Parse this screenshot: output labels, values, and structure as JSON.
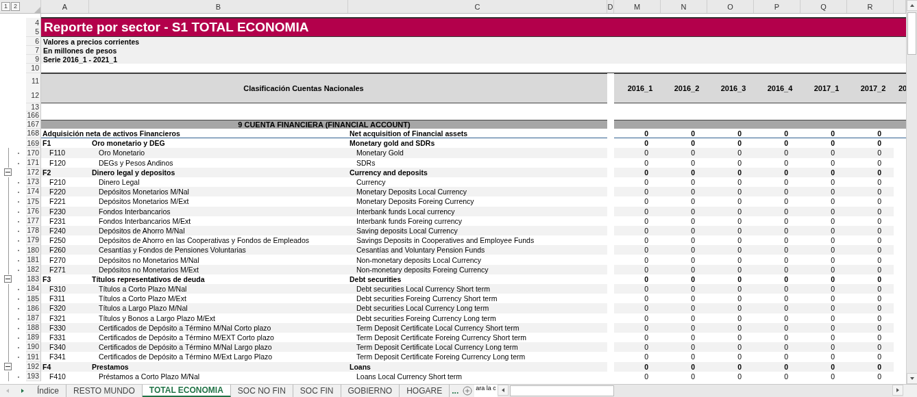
{
  "outline_levels": [
    "1",
    "2"
  ],
  "column_headers": [
    "A",
    "B",
    "C",
    "D",
    "M",
    "N",
    "O",
    "P",
    "Q",
    "R"
  ],
  "title": {
    "rows": [
      "4",
      "5"
    ],
    "text": "Reporte por sector - S1 TOTAL ECONOMIA"
  },
  "info_rows": [
    {
      "row": "6",
      "text": "Valores a precios corrientes"
    },
    {
      "row": "7",
      "text": "En millones de pesos"
    },
    {
      "row": "9",
      "text": "Serie 2016_1 - 2021_1"
    }
  ],
  "blank_rows": [
    "10"
  ],
  "header": {
    "rows": [
      "11",
      "12"
    ],
    "label": "Clasificación Cuentas Nacionales",
    "periods": [
      "2016_1",
      "2016_2",
      "2016_3",
      "2016_4",
      "2017_1",
      "2017_2",
      "20"
    ]
  },
  "spacer_rows": [
    "13",
    "166"
  ],
  "section": {
    "row": "167",
    "text": "9 CUENTA FINANCIERA (FINANCIAL ACCOUNT)"
  },
  "rows": [
    {
      "row": "168",
      "kind": "total",
      "label_es": "Adquisición neta de activos Financieros",
      "label_en": "Net acquisition of Financial assets",
      "values": [
        "0",
        "0",
        "0",
        "0",
        "0",
        "0"
      ]
    },
    {
      "row": "169",
      "kind": "group",
      "code": "F1",
      "label_es": "Oro monetario y DEG",
      "label_en": "Monetary gold and SDRs",
      "values": [
        "0",
        "0",
        "0",
        "0",
        "0",
        "0"
      ]
    },
    {
      "row": "170",
      "kind": "item",
      "code": "F110",
      "label_es": "Oro Monetario",
      "label_en": "Monetary Gold",
      "values": [
        "0",
        "0",
        "0",
        "0",
        "0",
        "0"
      ]
    },
    {
      "row": "171",
      "kind": "item",
      "code": "F120",
      "label_es": "DEGs y Pesos Andinos",
      "label_en": "SDRs",
      "values": [
        "0",
        "0",
        "0",
        "0",
        "0",
        "0"
      ]
    },
    {
      "row": "172",
      "kind": "group",
      "collapsible": true,
      "code": "F2",
      "label_es": "Dinero legal y depositos",
      "label_en": "Currency and deposits",
      "values": [
        "0",
        "0",
        "0",
        "0",
        "0",
        "0"
      ]
    },
    {
      "row": "173",
      "kind": "item",
      "code": "F210",
      "label_es": "Dinero Legal",
      "label_en": "Currency",
      "values": [
        "0",
        "0",
        "0",
        "0",
        "0",
        "0"
      ]
    },
    {
      "row": "174",
      "kind": "item",
      "code": "F220",
      "label_es": "Depósitos Monetarios M/Nal",
      "label_en": "Monetary Deposits Local Currency",
      "values": [
        "0",
        "0",
        "0",
        "0",
        "0",
        "0"
      ]
    },
    {
      "row": "175",
      "kind": "item",
      "code": "F221",
      "label_es": "Depósitos Monetarios M/Ext",
      "label_en": "Monetary Deposits Foreing Currency",
      "values": [
        "0",
        "0",
        "0",
        "0",
        "0",
        "0"
      ]
    },
    {
      "row": "176",
      "kind": "item",
      "code": "F230",
      "label_es": "Fondos Interbancarios",
      "label_en": "Interbank funds Local currency",
      "values": [
        "0",
        "0",
        "0",
        "0",
        "0",
        "0"
      ]
    },
    {
      "row": "177",
      "kind": "item",
      "code": "F231",
      "label_es": "Fondos Interbancarios M/Ext",
      "label_en": "Interbank funds Foreing currency",
      "values": [
        "0",
        "0",
        "0",
        "0",
        "0",
        "0"
      ]
    },
    {
      "row": "178",
      "kind": "item",
      "code": "F240",
      "label_es": "Depósitos de Ahorro M/Nal",
      "label_en": "Saving deposits Local Currency",
      "values": [
        "0",
        "0",
        "0",
        "0",
        "0",
        "0"
      ]
    },
    {
      "row": "179",
      "kind": "item",
      "code": "F250",
      "label_es": "Depósitos de Ahorro en las Cooperativas y Fondos de Empleados",
      "label_en": "Savings Deposits in Cooperatives and Employee Funds",
      "values": [
        "0",
        "0",
        "0",
        "0",
        "0",
        "0"
      ]
    },
    {
      "row": "180",
      "kind": "item",
      "code": "F260",
      "label_es": "Cesantías y Fondos de Pensiones Voluntarias",
      "label_en": "Cesantías and Voluntary Pension Funds",
      "values": [
        "0",
        "0",
        "0",
        "0",
        "0",
        "0"
      ]
    },
    {
      "row": "181",
      "kind": "item",
      "code": "F270",
      "label_es": "Depósitos no Monetarios M/Nal",
      "label_en": "Non-monetary deposits Local Currency",
      "values": [
        "0",
        "0",
        "0",
        "0",
        "0",
        "0"
      ]
    },
    {
      "row": "182",
      "kind": "item",
      "code": "F271",
      "label_es": "Depósitos no Monetarios M/Ext",
      "label_en": "Non-monetary deposits Foreing Currency",
      "values": [
        "0",
        "0",
        "0",
        "0",
        "0",
        "0"
      ]
    },
    {
      "row": "183",
      "kind": "group",
      "collapsible": true,
      "code": "F3",
      "label_es": "Títulos representativos de deuda",
      "label_en": "Debt securities",
      "values": [
        "0",
        "0",
        "0",
        "0",
        "0",
        "0"
      ]
    },
    {
      "row": "184",
      "kind": "item",
      "code": "F310",
      "label_es": "Títulos a Corto Plazo M/Nal",
      "label_en": "Debt securities Local Currency Short term",
      "values": [
        "0",
        "0",
        "0",
        "0",
        "0",
        "0"
      ]
    },
    {
      "row": "185",
      "kind": "item",
      "code": "F311",
      "label_es": "Títulos a Corto Plazo M/Ext",
      "label_en": "Debt securities Foreing Currency Short term",
      "values": [
        "0",
        "0",
        "0",
        "0",
        "0",
        "0"
      ]
    },
    {
      "row": "186",
      "kind": "item",
      "code": "F320",
      "label_es": "Títulos a Largo Plazo M/Nal",
      "label_en": "Debt securities Local Currency Long term",
      "values": [
        "0",
        "0",
        "0",
        "0",
        "0",
        "0"
      ]
    },
    {
      "row": "187",
      "kind": "item",
      "code": "F321",
      "label_es": "Títulos y Bonos a Largo Plazo M/Ext",
      "label_en": "Debt securities Foreing Currency Long term",
      "values": [
        "0",
        "0",
        "0",
        "0",
        "0",
        "0"
      ]
    },
    {
      "row": "188",
      "kind": "item",
      "code": "F330",
      "label_es": "Certificados de Depósito a Término M/Nal Corto plazo",
      "label_en": "Term Deposit Certificate Local Currency Short term",
      "values": [
        "0",
        "0",
        "0",
        "0",
        "0",
        "0"
      ]
    },
    {
      "row": "189",
      "kind": "item",
      "code": "F331",
      "label_es": "Certificados de Depósito a Término M/EXT Corto plazo",
      "label_en": "Term Deposit Certificate Foreing Currency Short term",
      "values": [
        "0",
        "0",
        "0",
        "0",
        "0",
        "0"
      ]
    },
    {
      "row": "190",
      "kind": "item",
      "code": "F340",
      "label_es": "Certificados de Depósito a Término M/Nal Largo plazo",
      "label_en": "Term Deposit Certificate Local Currency Long term",
      "values": [
        "0",
        "0",
        "0",
        "0",
        "0",
        "0"
      ]
    },
    {
      "row": "191",
      "kind": "item",
      "code": "F341",
      "label_es": "Certificados de Depósito a Término M/Ext Largo Plazo",
      "label_en": "Term Deposit Certificate Foreing Currency Long term",
      "values": [
        "0",
        "0",
        "0",
        "0",
        "0",
        "0"
      ]
    },
    {
      "row": "192",
      "kind": "group",
      "collapsible": true,
      "code": "F4",
      "label_es": "Prestamos",
      "label_en": "Loans",
      "values": [
        "0",
        "0",
        "0",
        "0",
        "0",
        "0"
      ]
    },
    {
      "row": "193",
      "kind": "item",
      "code": "F410",
      "label_es": "Préstamos a Corto Plazo M/Nal",
      "label_en": "Loans Local Currency Short term",
      "values": [
        "0",
        "0",
        "0",
        "0",
        "0",
        "0"
      ]
    }
  ],
  "sheet_tabs": [
    {
      "label": "Índice",
      "selected": false
    },
    {
      "label": "RESTO MUNDO",
      "selected": false
    },
    {
      "label": "TOTAL ECONOMIA",
      "selected": true
    },
    {
      "label": "SOC NO FIN",
      "selected": false
    },
    {
      "label": "SOC FIN",
      "selected": false
    },
    {
      "label": "GOBIERNO",
      "selected": false
    },
    {
      "label": "HOGARE",
      "selected": false
    }
  ],
  "tab_overflow": "...",
  "cell_preview": "ara la c"
}
